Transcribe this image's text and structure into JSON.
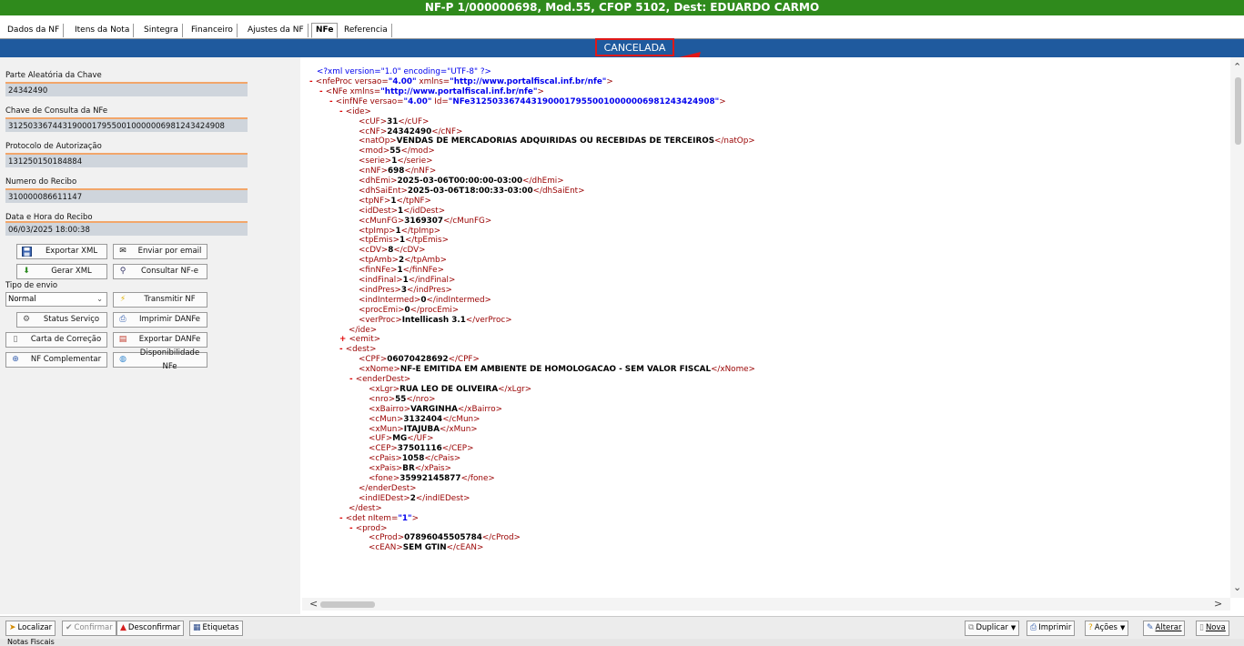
{
  "window": {
    "title": "NF-P 1/000000698, Mod.55, CFOP 5102, Dest: EDUARDO CARMO"
  },
  "tabs": [
    "Dados da NF",
    "Itens da Nota",
    "Sintegra",
    "Financeiro",
    "Ajustes da NF",
    "NFe",
    "Referencia"
  ],
  "active_tab": "NFe",
  "status": {
    "text": "CANCELADA",
    "highlight_color": "#e01818"
  },
  "fields": {
    "parte_aleatoria": {
      "label": "Parte Aleatória da Chave",
      "value": "24342490"
    },
    "chave": {
      "label": "Chave de Consulta da NFe",
      "value": "31250336744319000179550010000006981243424908"
    },
    "protocolo": {
      "label": "Protocolo de Autorização",
      "value": "131250150184884"
    },
    "recibo": {
      "label": "Numero do Recibo",
      "value": "310000086611147"
    },
    "data_hora": {
      "label": "Data e Hora do Recibo",
      "value": "06/03/2025 18:00:38"
    }
  },
  "tipo_envio": {
    "label": "Tipo de envio",
    "value": "Normal"
  },
  "buttons": {
    "exportar_xml": "Exportar XML",
    "enviar_email": "Enviar por email",
    "gerar_xml": "Gerar XML",
    "consultar_nfe": "Consultar NF-e",
    "transmitir_nf": "Transmitir NF",
    "status_servico": "Status Serviço",
    "imprimir_danfe": "Imprimir DANFe",
    "carta_correcao": "Carta de Correção",
    "exportar_danfe": "Exportar DANFe",
    "nf_complementar": "NF Complementar",
    "disponibilidade": "Disponibilidade NFe"
  },
  "bottom": {
    "localizar": "Localizar",
    "confirmar": "Confirmar",
    "desconfirmar": "Desconfirmar",
    "etiquetas": "Etiquetas",
    "duplicar": "Duplicar",
    "imprimir": "Imprimir",
    "acoes": "Ações",
    "alterar": "Alterar",
    "nova": "Nova"
  },
  "footer_tab": "Notas Fiscais",
  "xml": {
    "decl": "<?xml version=\"1.0\" encoding=\"UTF-8\" ?>",
    "lines": [
      {
        "m": "-",
        "t": "nfeProc",
        "a": [
          [
            "versao",
            "4.00"
          ],
          [
            "xmlns",
            "http://www.portalfiscal.inf.br/nfe"
          ]
        ]
      },
      {
        "m": "-",
        "t": "NFe",
        "a": [
          [
            "xmlns",
            "http://www.portalfiscal.inf.br/nfe"
          ]
        ]
      },
      {
        "m": "-",
        "t": "infNFe",
        "a": [
          [
            "versao",
            "4.00"
          ],
          [
            "Id",
            "NFe31250336744319000179550010000006981243424908"
          ]
        ]
      },
      {
        "m": "-",
        "t": "ide"
      },
      {
        "t": "cUF",
        "v": "31"
      },
      {
        "t": "cNF",
        "v": "24342490"
      },
      {
        "t": "natOp",
        "v": "VENDAS DE MERCADORIAS ADQUIRIDAS OU RECEBIDAS DE TERCEIROS"
      },
      {
        "t": "mod",
        "v": "55"
      },
      {
        "t": "serie",
        "v": "1"
      },
      {
        "t": "nNF",
        "v": "698"
      },
      {
        "t": "dhEmi",
        "v": "2025-03-06T00:00:00-03:00"
      },
      {
        "t": "dhSaiEnt",
        "v": "2025-03-06T18:00:33-03:00"
      },
      {
        "t": "tpNF",
        "v": "1"
      },
      {
        "t": "idDest",
        "v": "1"
      },
      {
        "t": "cMunFG",
        "v": "3169307"
      },
      {
        "t": "tpImp",
        "v": "1"
      },
      {
        "t": "tpEmis",
        "v": "1"
      },
      {
        "t": "cDV",
        "v": "8"
      },
      {
        "t": "tpAmb",
        "v": "2"
      },
      {
        "t": "finNFe",
        "v": "1"
      },
      {
        "t": "indFinal",
        "v": "1"
      },
      {
        "t": "indPres",
        "v": "3"
      },
      {
        "t": "indIntermed",
        "v": "0"
      },
      {
        "t": "procEmi",
        "v": "0"
      },
      {
        "t": "verProc",
        "v": "Intellicash 3.1"
      },
      {
        "c": "ide"
      },
      {
        "m": "+",
        "t": "emit"
      },
      {
        "m": "-",
        "t": "dest"
      },
      {
        "t": "CPF",
        "v": "06070428692"
      },
      {
        "t": "xNome",
        "v": "NF-E EMITIDA EM AMBIENTE DE HOMOLOGACAO - SEM VALOR FISCAL"
      },
      {
        "m": "-",
        "t": "enderDest"
      },
      {
        "t": "xLgr",
        "v": "RUA LEO DE OLIVEIRA"
      },
      {
        "t": "nro",
        "v": "55"
      },
      {
        "t": "xBairro",
        "v": "VARGINHA"
      },
      {
        "t": "cMun",
        "v": "3132404"
      },
      {
        "t": "xMun",
        "v": "ITAJUBA"
      },
      {
        "t": "UF",
        "v": "MG"
      },
      {
        "t": "CEP",
        "v": "37501116"
      },
      {
        "t": "cPais",
        "v": "1058"
      },
      {
        "t": "xPais",
        "v": "BR"
      },
      {
        "t": "fone",
        "v": "35992145877"
      },
      {
        "c": "enderDest"
      },
      {
        "t": "indIEDest",
        "v": "2"
      },
      {
        "c": "dest"
      },
      {
        "m": "-",
        "t": "det",
        "a": [
          [
            "nItem",
            "1"
          ]
        ]
      },
      {
        "m": "-",
        "t": "prod"
      },
      {
        "t": "cProd",
        "v": "07896045505784"
      },
      {
        "t": "cEAN",
        "v": "SEM GTIN"
      }
    ]
  }
}
